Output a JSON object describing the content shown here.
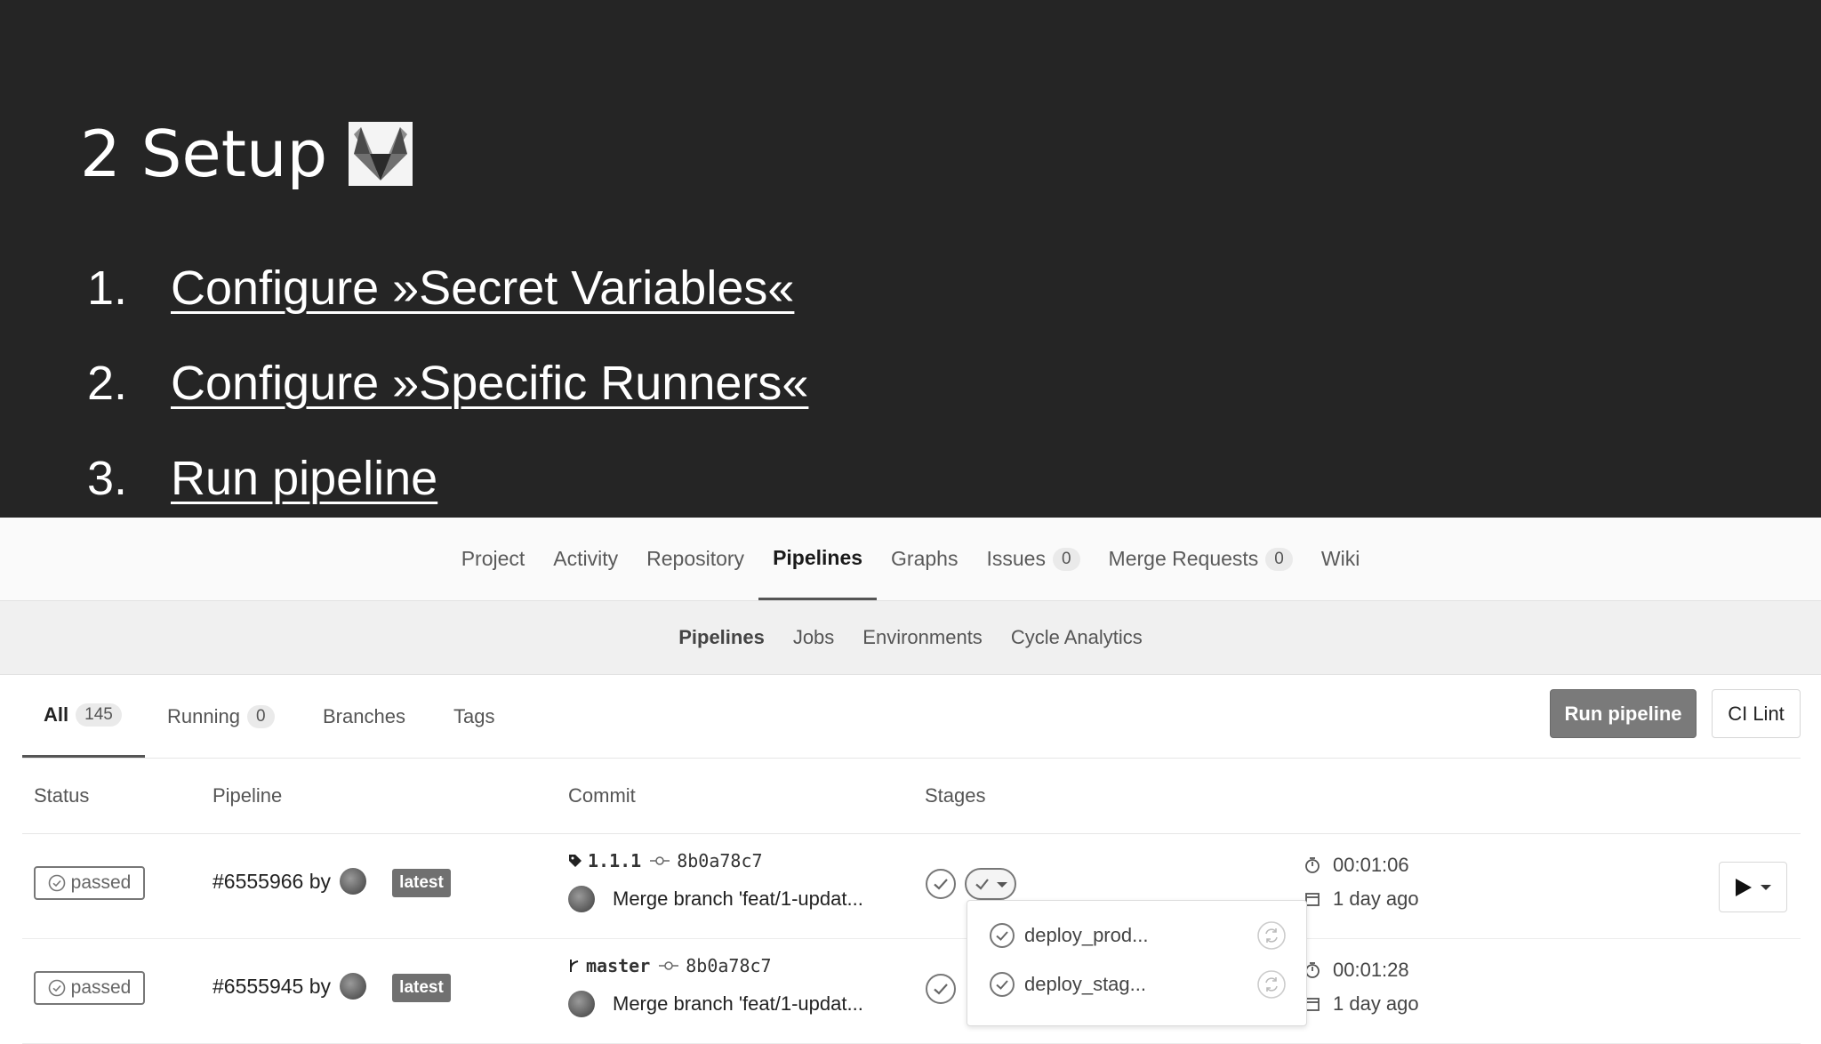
{
  "slide": {
    "title": "2 Setup",
    "steps": [
      {
        "num": "1.",
        "label": "Configure »Secret Variables«"
      },
      {
        "num": "2.",
        "label": "Configure »Specific Runners«"
      },
      {
        "num": "3.",
        "label": "Run pipeline"
      }
    ]
  },
  "top_nav": {
    "project": "Project",
    "activity": "Activity",
    "repository": "Repository",
    "pipelines": "Pipelines",
    "graphs": "Graphs",
    "issues": "Issues",
    "issues_count": "0",
    "merge_requests": "Merge Requests",
    "merge_requests_count": "0",
    "wiki": "Wiki"
  },
  "sub_nav": {
    "pipelines": "Pipelines",
    "jobs": "Jobs",
    "environments": "Environments",
    "cycle_analytics": "Cycle Analytics"
  },
  "tabs": {
    "all": "All",
    "all_count": "145",
    "running": "Running",
    "running_count": "0",
    "branches": "Branches",
    "tags": "Tags"
  },
  "actions": {
    "run_pipeline": "Run pipeline",
    "ci_lint": "CI Lint"
  },
  "table": {
    "headers": {
      "status": "Status",
      "pipeline": "Pipeline",
      "commit": "Commit",
      "stages": "Stages"
    },
    "rows": [
      {
        "status": "passed",
        "pipeline": "#6555966 by",
        "tag": "latest",
        "ref_icon": "tag-icon",
        "ref": "1.1.1",
        "sha": "8b0a78c7",
        "message": "Merge branch 'feat/1-updat...",
        "duration": "00:01:06",
        "finished": "1 day ago"
      },
      {
        "status": "passed",
        "pipeline": "#6555945 by",
        "tag": "latest",
        "ref_icon": "branch-icon",
        "ref": "master",
        "sha": "8b0a78c7",
        "message": "Merge branch 'feat/1-updat...",
        "duration": "00:01:28",
        "finished": "1 day ago"
      }
    ]
  },
  "stage_dropdown": {
    "items": [
      "deploy_prod...",
      "deploy_stag..."
    ]
  }
}
